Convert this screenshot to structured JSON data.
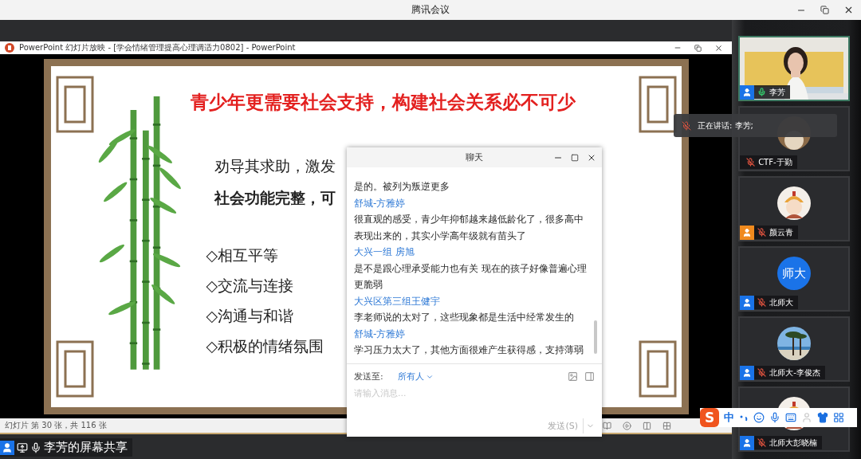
{
  "app": {
    "title": "腾讯会议"
  },
  "ppt_window": {
    "title": "PowerPoint 幻灯片放映 - [学会情绪管理提高心理调适力0802] - PowerPoint",
    "status": "幻灯片 第 30 张，共 116 张"
  },
  "slide": {
    "title": "青少年更需要社会支持，构建社会关系必不可少",
    "lines": [
      {
        "text": "劝导其求助，激发",
        "bold": false
      },
      {
        "text": "社会功能完整，可",
        "bold": true
      }
    ],
    "bullets": [
      "◇相互平等",
      "◇交流与连接",
      "◇沟通与和谐",
      "◇积极的情绪氛围"
    ]
  },
  "share_label": "李芳的屏幕共享",
  "chat": {
    "title": "聊天",
    "messages": [
      {
        "kind": "text",
        "text": "是的。被列为叛逆更多"
      },
      {
        "kind": "sender",
        "text": "舒城-方雅婷"
      },
      {
        "kind": "text",
        "text": "很直观的感受，青少年抑郁越来越低龄化了，很多高中表现出来的，其实小学高年级就有苗头了"
      },
      {
        "kind": "sender",
        "text": "大兴一组 房旭"
      },
      {
        "kind": "text",
        "text": "是不是跟心理承受能力也有关 现在的孩子好像普遍心理更脆弱"
      },
      {
        "kind": "sender",
        "text": "大兴区第三组王健宇"
      },
      {
        "kind": "text",
        "text": "李老师说的太对了，这些现象都是生活中经常发生的"
      },
      {
        "kind": "sender",
        "text": "舒城-方雅婷"
      },
      {
        "kind": "text",
        "text": "学习压力太大了，其他方面很难产生获得感，支持薄弱"
      }
    ],
    "send_to_label": "发送至:",
    "recipient": "所有人",
    "placeholder": "请输入消息...",
    "send_button": "发送(S)"
  },
  "participants": [
    {
      "name": "李芳",
      "color": "#1a73e8",
      "muted": false,
      "kind": "video",
      "selected": true
    },
    {
      "name": "CTF-于勤",
      "muted": true,
      "selected": false
    },
    {
      "name": "颜云青",
      "color": "#f08a1e",
      "muted": true,
      "kind": "cartoon",
      "selected": false
    },
    {
      "name": "北师大",
      "color": "#1a73e8",
      "muted": true,
      "kind": "initials",
      "initials": "师大",
      "selected": false
    },
    {
      "name": "北师大-李俊杰",
      "color": "#1a73e8",
      "muted": true,
      "kind": "beach",
      "selected": false
    },
    {
      "name": "北师大彭晓楠",
      "color": "#1a73e8",
      "muted": true,
      "kind": "cartoon",
      "selected": false
    }
  ],
  "speaking_toast": "正在讲话: 李芳;",
  "ime_toolbar": {
    "logo": "S",
    "mode": "中"
  }
}
